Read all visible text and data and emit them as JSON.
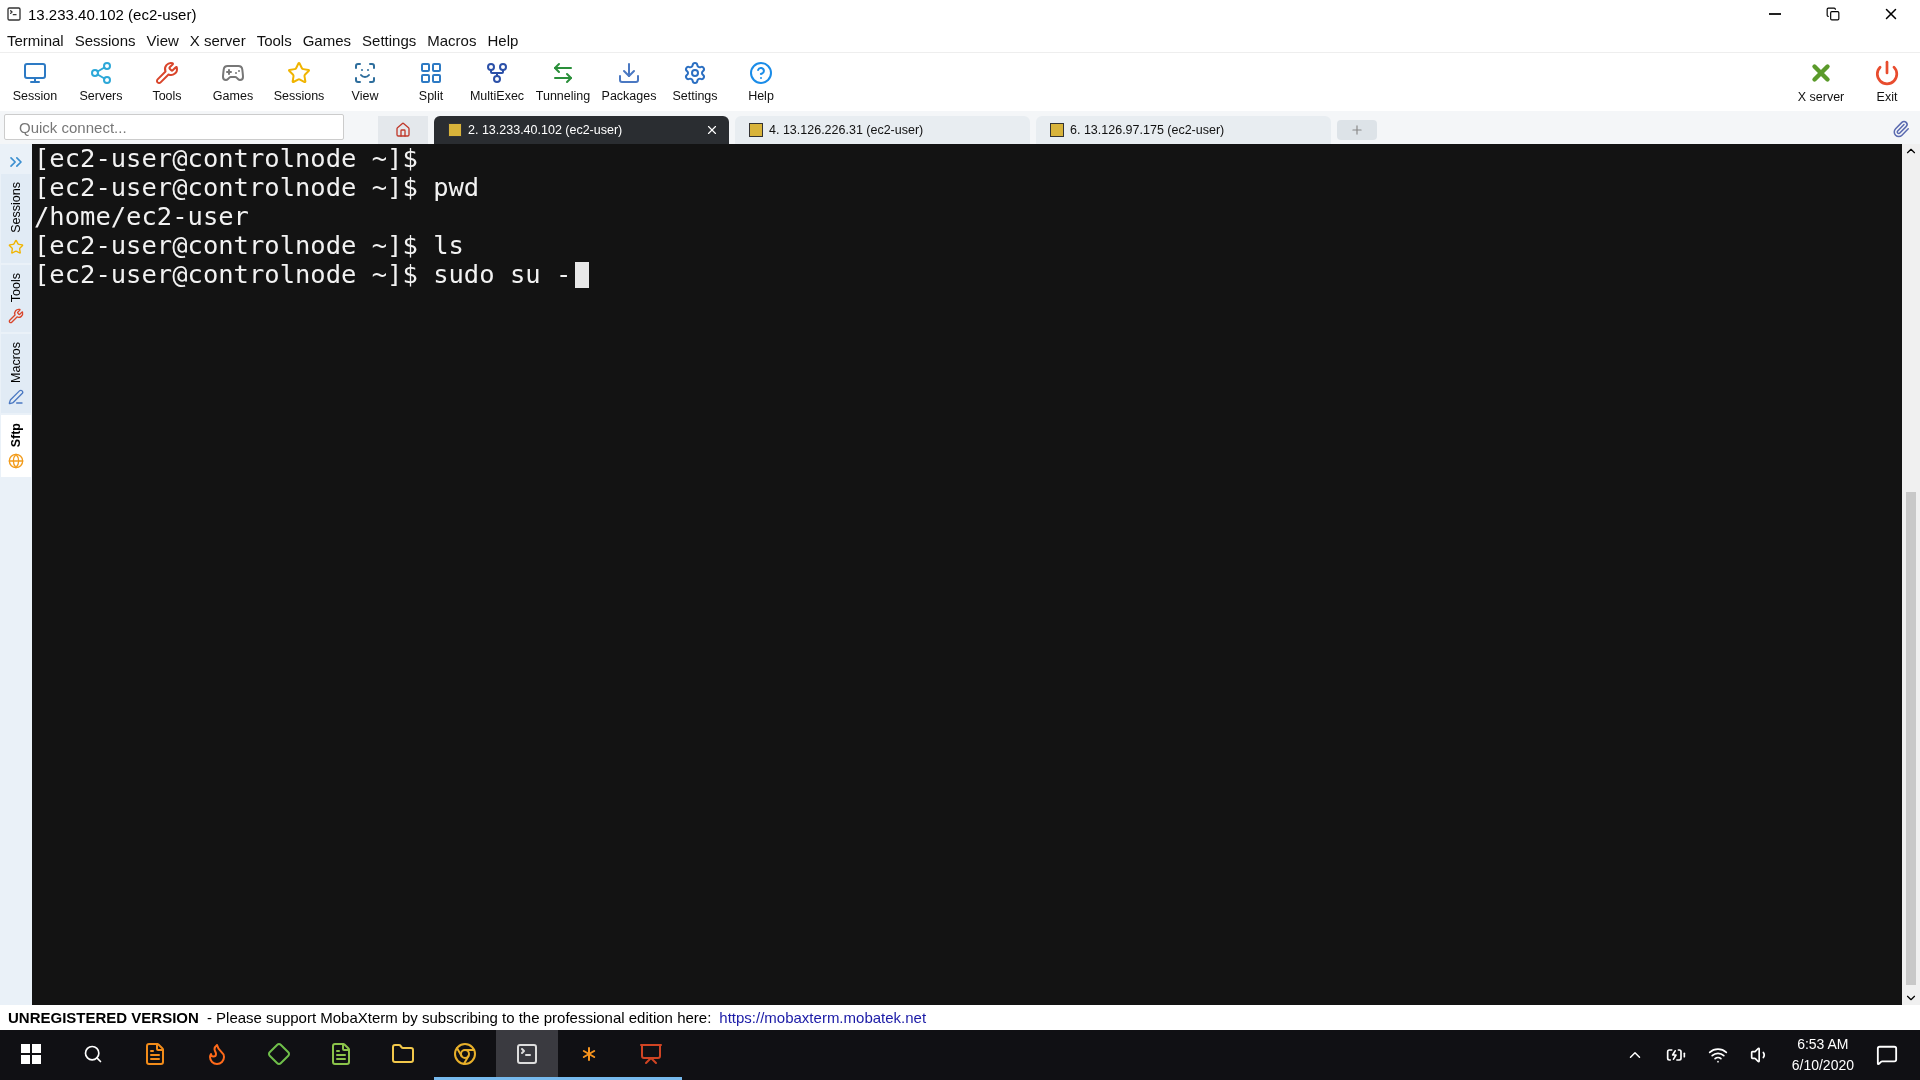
{
  "window": {
    "title": "13.233.40.102 (ec2-user)"
  },
  "menu": [
    "Terminal",
    "Sessions",
    "View",
    "X server",
    "Tools",
    "Games",
    "Settings",
    "Macros",
    "Help"
  ],
  "toolbar": [
    {
      "label": "Session"
    },
    {
      "label": "Servers"
    },
    {
      "label": "Tools"
    },
    {
      "label": "Games"
    },
    {
      "label": "Sessions"
    },
    {
      "label": "View"
    },
    {
      "label": "Split"
    },
    {
      "label": "MultiExec"
    },
    {
      "label": "Tunneling"
    },
    {
      "label": "Packages"
    },
    {
      "label": "Settings"
    },
    {
      "label": "Help"
    }
  ],
  "toolbar_right": [
    {
      "label": "X server"
    },
    {
      "label": "Exit"
    }
  ],
  "quick_connect": {
    "placeholder": "Quick connect..."
  },
  "tabs": [
    {
      "label": "2. 13.233.40.102 (ec2-user)",
      "selected": true
    },
    {
      "label": "4. 13.126.226.31 (ec2-user)",
      "selected": false
    },
    {
      "label": "6. 13.126.97.175 (ec2-user)",
      "selected": false
    }
  ],
  "side_tabs": [
    {
      "label": "Sessions",
      "selected": false
    },
    {
      "label": "Tools",
      "selected": false
    },
    {
      "label": "Macros",
      "selected": false
    },
    {
      "label": "Sftp",
      "selected": true
    }
  ],
  "terminal": {
    "lines": [
      "[ec2-user@controlnode ~]$",
      "[ec2-user@controlnode ~]$ pwd",
      "/home/ec2-user",
      "[ec2-user@controlnode ~]$ ls",
      "[ec2-user@controlnode ~]$ sudo su -"
    ],
    "cursor": true
  },
  "status_bar": {
    "label": "UNREGISTERED VERSION",
    "message": "-  Please support MobaXterm by subscribing to the professional edition here:",
    "link": "https://mobaxterm.mobatek.net"
  },
  "taskbar": {
    "apps": [
      {
        "running": false,
        "selected": false
      },
      {
        "running": false,
        "selected": false
      },
      {
        "running": false,
        "selected": false
      },
      {
        "running": false,
        "selected": false
      },
      {
        "running": false,
        "selected": false
      },
      {
        "running": true,
        "selected": false
      },
      {
        "running": true,
        "selected": true
      },
      {
        "running": true,
        "selected": false
      },
      {
        "running": true,
        "selected": false
      }
    ],
    "time": "6:53 AM",
    "date": "6/10/2020"
  }
}
